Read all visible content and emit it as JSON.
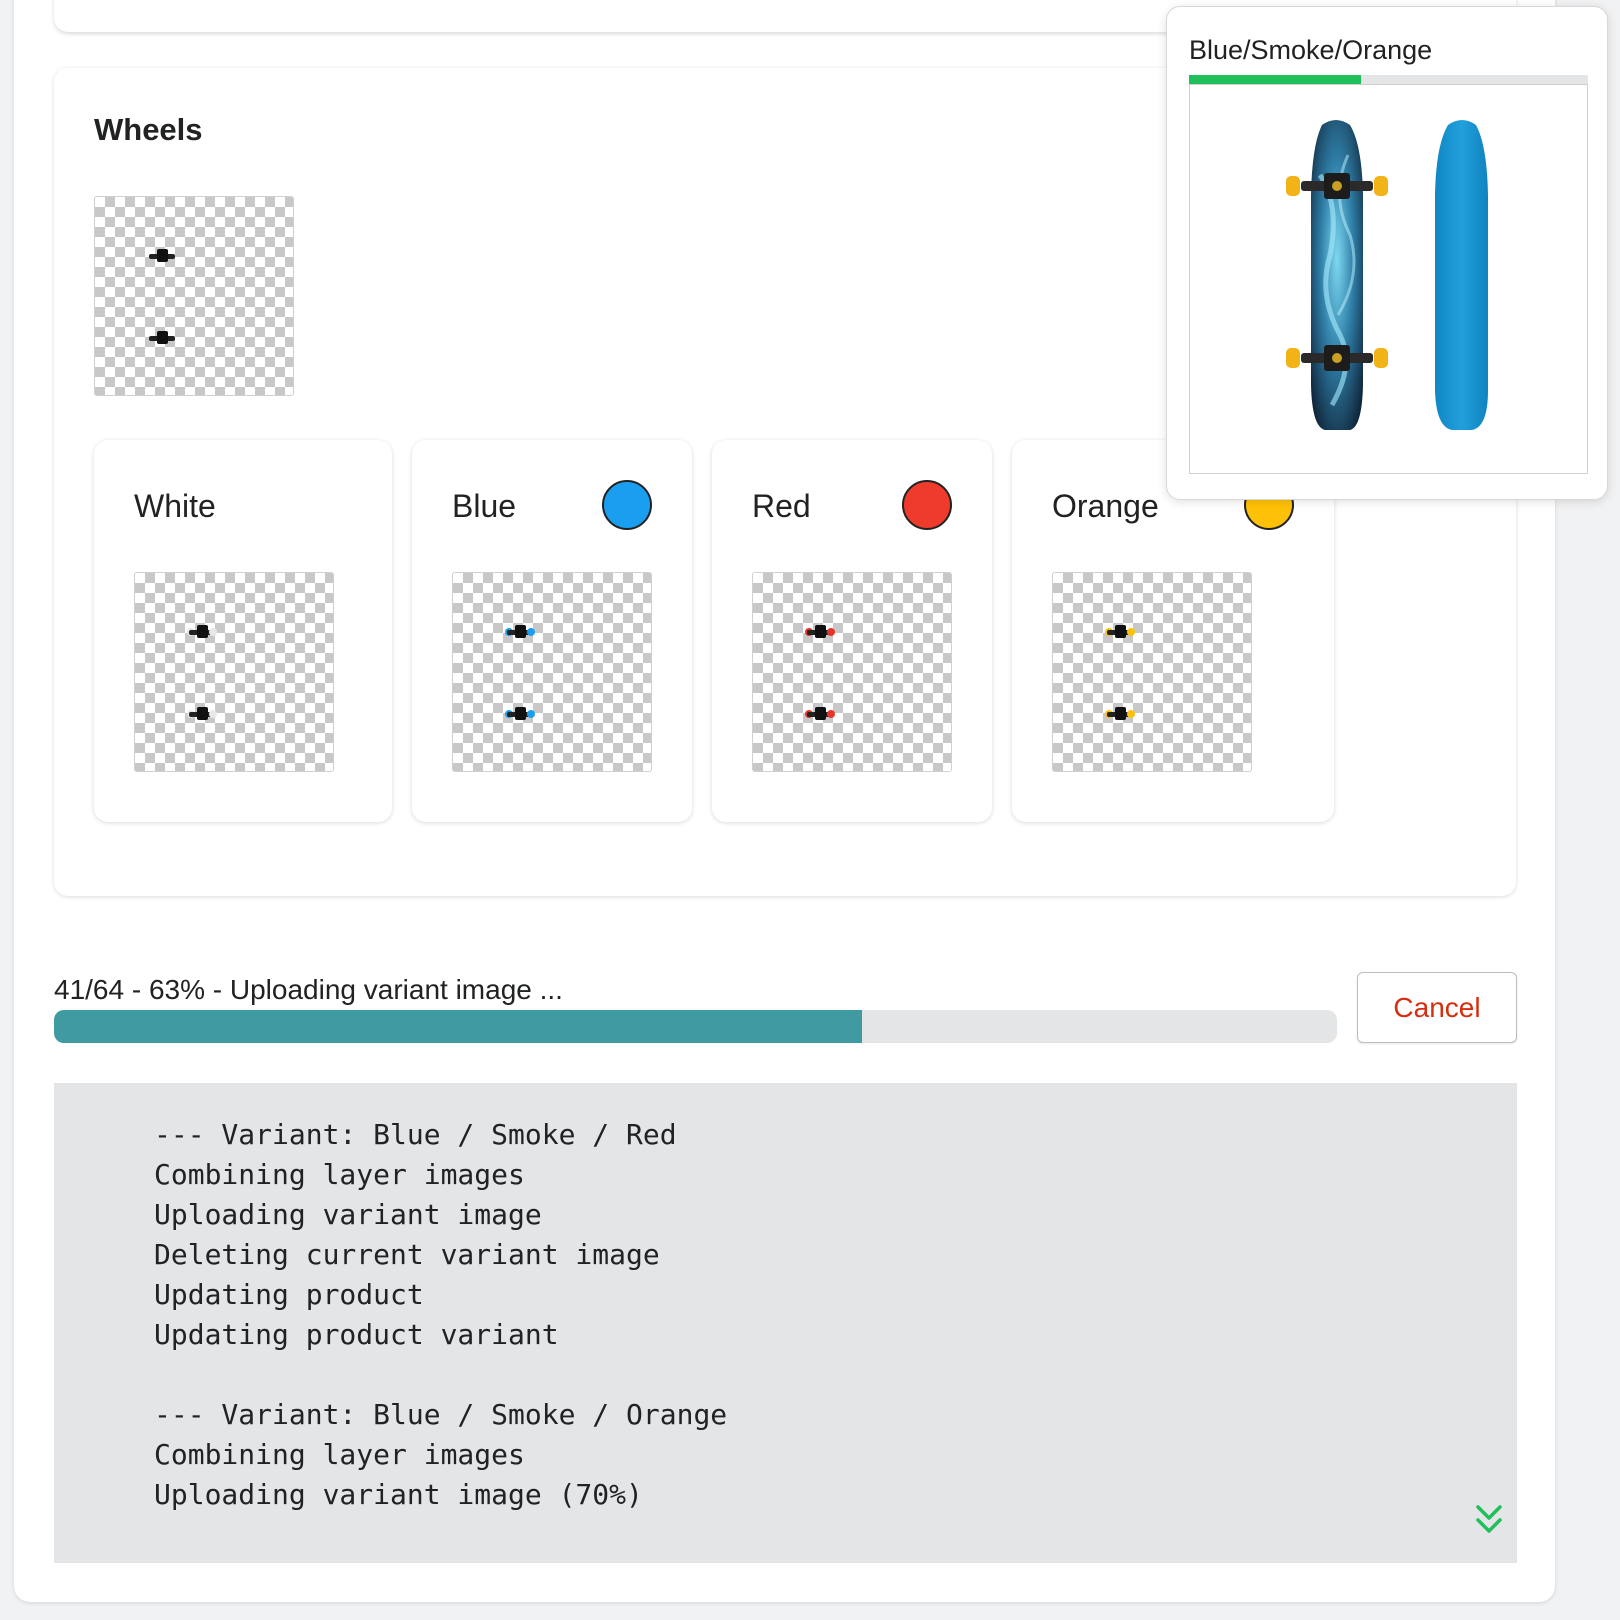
{
  "section": {
    "title": "Wheels"
  },
  "options": [
    {
      "name": "White",
      "swatch": null,
      "wheel_color": "#e8e8e8"
    },
    {
      "name": "Blue",
      "swatch": "#1a9ff0",
      "wheel_color": "#1a9ff0"
    },
    {
      "name": "Red",
      "swatch": "#ef3b2c",
      "wheel_color": "#e8342a"
    },
    {
      "name": "Orange",
      "swatch": "#ffc107",
      "wheel_color": "#ffc107"
    }
  ],
  "preview": {
    "title": "Blue/Smoke/Orange",
    "progress_fraction": 0.43
  },
  "progress": {
    "text": "41/64 - 63% - Uploading variant image ...",
    "fraction": 0.63,
    "cancel_label": "Cancel"
  },
  "log": {
    "lines": [
      "--- Variant: Blue / Smoke / Red",
      "Combining layer images",
      "Uploading variant image",
      "Deleting current variant image",
      "Updating product",
      "Updating product variant",
      "",
      "--- Variant: Blue / Smoke / Orange",
      "Combining layer images",
      "Uploading variant image (70%)"
    ]
  },
  "colors": {
    "progress": "#3f9aa2",
    "preview_progress": "#1fbf5c",
    "cancel_text": "#d72c0d",
    "scroll_icon": "#1fbf5c"
  }
}
